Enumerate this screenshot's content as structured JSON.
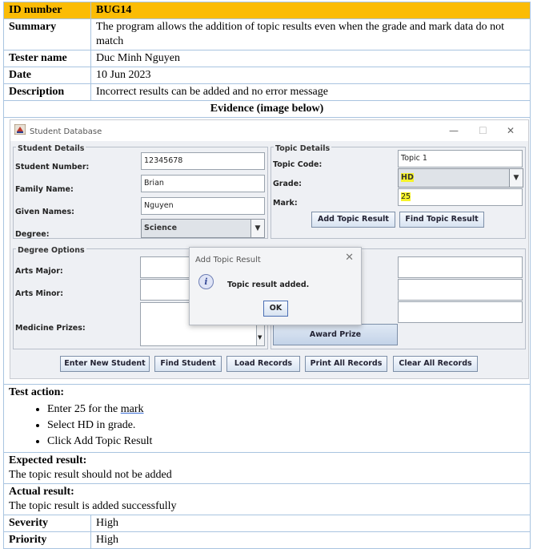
{
  "report": {
    "id_label": "ID number",
    "id_value": "BUG14",
    "summary_label": "Summary",
    "summary_value": "The program allows the addition of topic results even when the grade and mark data do not match",
    "tester_label": "Tester name",
    "tester_value": "Duc Minh Nguyen",
    "date_label": "Date",
    "date_value": "10 Jun 2023",
    "description_label": "Description",
    "description_value": "Incorrect results can be added and no error message",
    "evidence_label": "Evidence (image below)",
    "test_action_label": "Test action:",
    "test_actions": [
      "Enter 25 for the ",
      "Select HD in grade.",
      "Click Add Topic Result"
    ],
    "test_action_underlined_word": "mark",
    "expected_label": "Expected result:",
    "expected_value": "The topic result should not be added",
    "actual_label": "Actual result:",
    "actual_value": "The topic result is added successfully",
    "severity_label": "Severity",
    "severity_value": "High",
    "priority_label": "Priority",
    "priority_value": "High",
    "header_color": "#fbbc05"
  },
  "app": {
    "window_title": "Student Database",
    "student_details": {
      "group_label": "Student Details",
      "student_number_label": "Student Number:",
      "student_number_value": "12345678",
      "family_name_label": "Family Name:",
      "family_name_value": "Brian",
      "given_names_label": "Given Names:",
      "given_names_value": "Nguyen",
      "degree_label": "Degree:",
      "degree_value": "Science"
    },
    "topic_details": {
      "group_label": "Topic Details",
      "topic_code_label": "Topic Code:",
      "topic_code_value": "Topic 1",
      "grade_label": "Grade:",
      "grade_value": "HD",
      "mark_label": "Mark:",
      "mark_value": "25",
      "add_button": "Add Topic Result",
      "find_button": "Find Topic Result"
    },
    "degree_options": {
      "group_label": "Degree Options",
      "arts_major_label": "Arts Major:",
      "arts_minor_label": "Arts Minor:",
      "medicine_prizes_label": "Medicine Prizes:"
    },
    "award_prize_button": "Award Prize",
    "bottom_buttons": [
      "Enter New Student",
      "Find Student",
      "Load Records",
      "Print All Records",
      "Clear All Records"
    ],
    "dialog": {
      "title": "Add Topic Result",
      "message": "Topic result added.",
      "ok_label": "OK",
      "icon": "info-icon"
    },
    "highlight_color": "#f6f32a"
  }
}
